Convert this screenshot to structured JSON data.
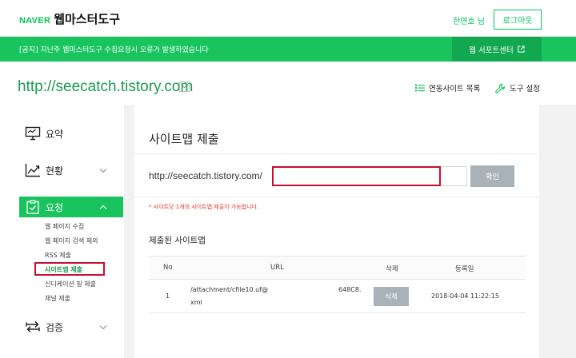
{
  "header": {
    "logo_naver": "NAVER",
    "logo_title": "웹마스터도구",
    "user_name": "한연호 님",
    "logout_label": "로그아웃"
  },
  "notice": {
    "text": "[공지] 지난주 웹마스터도구 수집요청시 오류가 발생하였습니다",
    "support_label": "웹 서포트센터"
  },
  "site": {
    "url": "http://seecatch.tistory.com",
    "linked_sites_label": "연동사이트 목록",
    "tool_settings_label": "도구 설정"
  },
  "sidebar": {
    "items": [
      {
        "label": "요약",
        "icon": "presentation-board-icon"
      },
      {
        "label": "현황",
        "icon": "line-chart-icon"
      },
      {
        "label": "요청",
        "icon": "clipboard-check-icon"
      },
      {
        "label": "검증",
        "icon": "swap-arrows-icon"
      }
    ],
    "sub_items": [
      {
        "label": "웹 페이지 수집"
      },
      {
        "label": "웹 페이지 검색 제외"
      },
      {
        "label": "RSS 제출"
      },
      {
        "label": "사이트맵 제출"
      },
      {
        "label": "신디케이션 핑 제출"
      },
      {
        "label": "채널 제출"
      }
    ]
  },
  "main": {
    "title": "사이트맵 제출",
    "prefix_url": "http://seecatch.tistory.com/",
    "input_value": "",
    "confirm_label": "확인",
    "notice_text": "* 사이트당 1개의 사이트맵 제출이 가능합니다.",
    "submitted_title": "제출된 사이트맵",
    "table": {
      "headers": {
        "no": "No",
        "url": "URL",
        "delete": "삭제",
        "date": "등록일"
      },
      "rows": [
        {
          "no": "1",
          "url_line1": "/attachment/cfile10.uf@",
          "url_tail": "648C8.",
          "url_line2": "xml",
          "delete_label": "삭제",
          "date": "2018-04-04 11:22:15"
        }
      ]
    }
  },
  "colors": {
    "brand_green": "#19c45e",
    "dark_green": "#12a84f",
    "highlight_red": "#c8102e",
    "button_gray": "#aab2b9"
  }
}
